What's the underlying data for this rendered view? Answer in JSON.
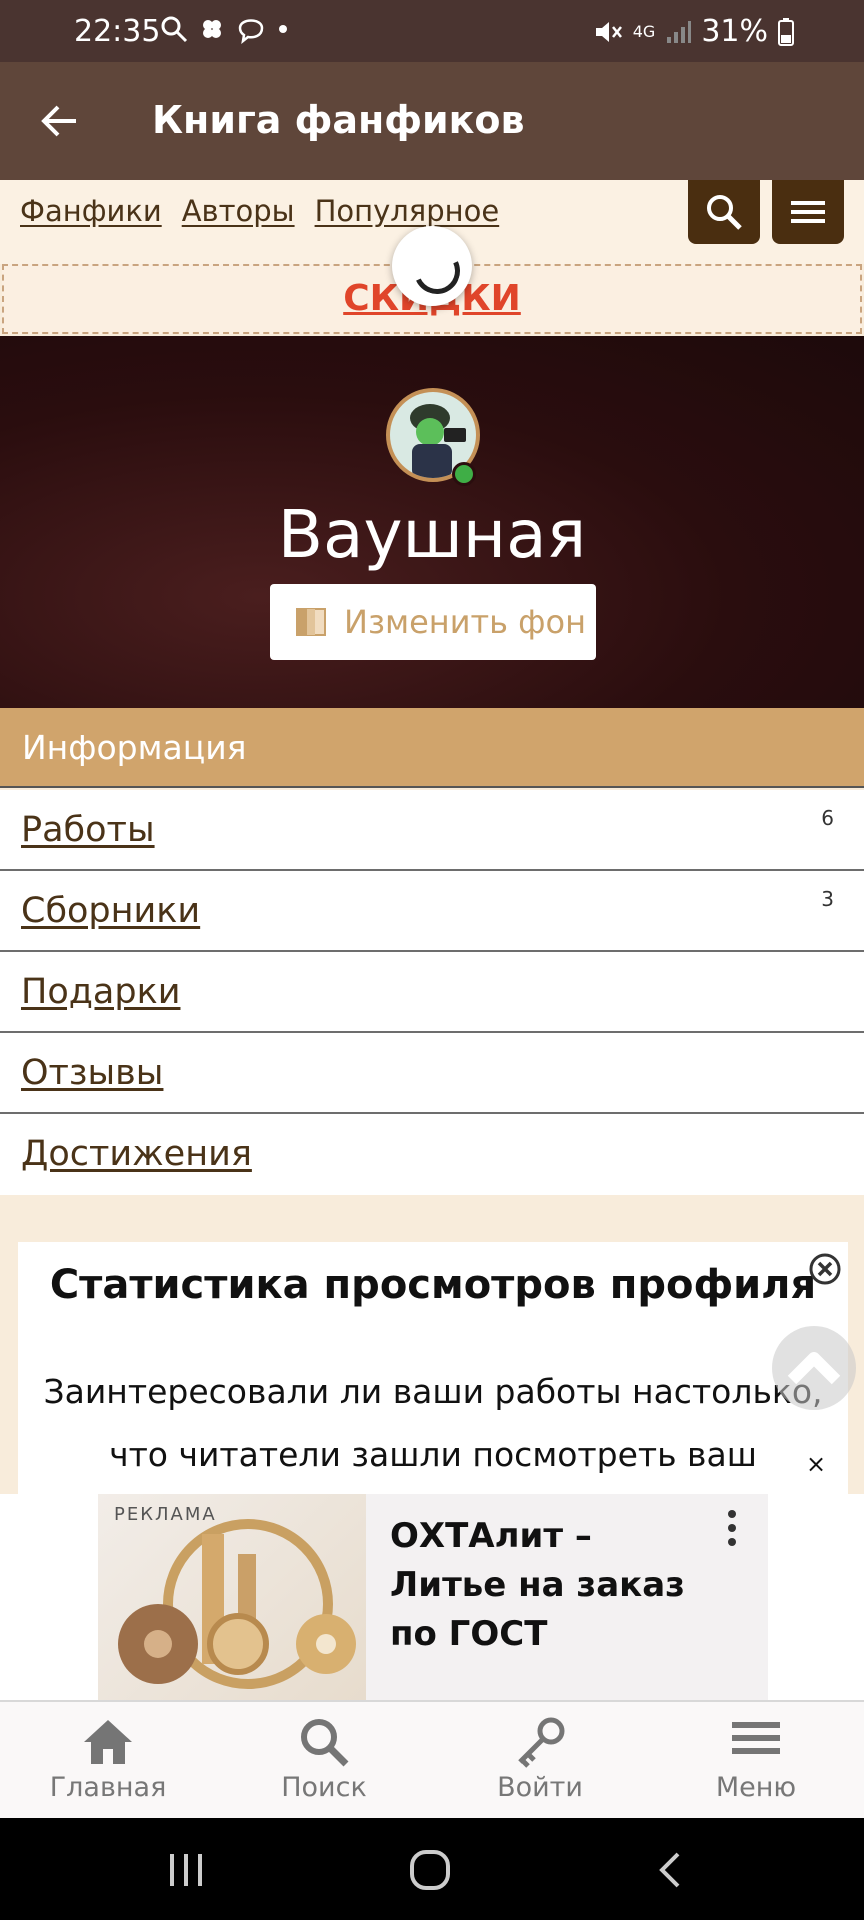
{
  "status_bar": {
    "time": "22:35",
    "battery": "31%",
    "network": "4G"
  },
  "app_bar": {
    "title": "Книга фанфиков"
  },
  "site_nav": {
    "links": [
      "Фанфики",
      "Авторы",
      "Популярное"
    ]
  },
  "promo": {
    "text": "СКИДКИ"
  },
  "profile": {
    "username": "Ваушная",
    "change_bg_label": "Изменить фон"
  },
  "info": {
    "heading": "Информация",
    "items": [
      {
        "label": "Работы",
        "count": "6"
      },
      {
        "label": "Сборники",
        "count": "3"
      },
      {
        "label": "Подарки",
        "count": ""
      },
      {
        "label": "Отзывы",
        "count": ""
      },
      {
        "label": "Достижения",
        "count": ""
      }
    ]
  },
  "stats_card": {
    "title": "Статистика просмотров профиля",
    "text": "Заинтересовали ли ваши работы настолько, что читатели зашли посмотреть ваш"
  },
  "ad": {
    "label": "РЕКЛАМА",
    "text": "ОХТАлит – Литье на заказ по ГОСТ",
    "close": "×"
  },
  "bottom_nav": [
    {
      "label": "Главная",
      "icon": "home-icon"
    },
    {
      "label": "Поиск",
      "icon": "search-icon"
    },
    {
      "label": "Войти",
      "icon": "key-icon"
    },
    {
      "label": "Меню",
      "icon": "menu-icon"
    }
  ],
  "colors": {
    "appbar": "#5f463a",
    "accent": "#d0a46c",
    "promo": "#e0452a",
    "link": "#4a3318"
  }
}
